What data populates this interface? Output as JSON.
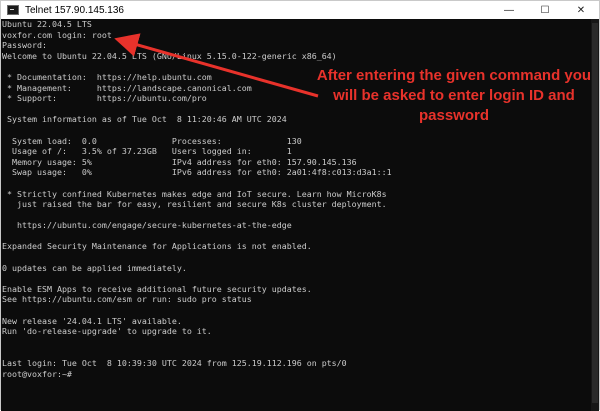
{
  "window": {
    "title": "Telnet 157.90.145.136",
    "controls": {
      "minimize_glyph": "—",
      "maximize_glyph": "☐",
      "close_glyph": "✕"
    }
  },
  "terminal": {
    "lines": [
      "Ubuntu 22.04.5 LTS",
      "voxfor.com login: root",
      "Password:",
      "Welcome to Ubuntu 22.04.5 LTS (GNU/Linux 5.15.0-122-generic x86_64)",
      "",
      " * Documentation:  https://help.ubuntu.com",
      " * Management:     https://landscape.canonical.com",
      " * Support:        https://ubuntu.com/pro",
      "",
      " System information as of Tue Oct  8 11:20:46 AM UTC 2024",
      "",
      "  System load:  0.0               Processes:             130",
      "  Usage of /:   3.5% of 37.23GB   Users logged in:       1",
      "  Memory usage: 5%                IPv4 address for eth0: 157.90.145.136",
      "  Swap usage:   0%                IPv6 address for eth0: 2a01:4f8:c013:d3a1::1",
      "",
      " * Strictly confined Kubernetes makes edge and IoT secure. Learn how MicroK8s",
      "   just raised the bar for easy, resilient and secure K8s cluster deployment.",
      "",
      "   https://ubuntu.com/engage/secure-kubernetes-at-the-edge",
      "",
      "Expanded Security Maintenance for Applications is not enabled.",
      "",
      "0 updates can be applied immediately.",
      "",
      "Enable ESM Apps to receive additional future security updates.",
      "See https://ubuntu.com/esm or run: sudo pro status",
      "",
      "New release '24.04.1 LTS' available.",
      "Run 'do-release-upgrade' to upgrade to it.",
      "",
      "",
      "Last login: Tue Oct  8 10:39:30 UTC 2024 from 125.19.112.196 on pts/0",
      "root@voxfor:~#"
    ]
  },
  "annotation": {
    "text": "After entering the given command you will be asked to enter login ID and password",
    "color": "#e8322b"
  },
  "colors": {
    "terminal_bg": "#0c0c0c",
    "terminal_fg": "#cccccc",
    "accent": "#e8322b"
  }
}
